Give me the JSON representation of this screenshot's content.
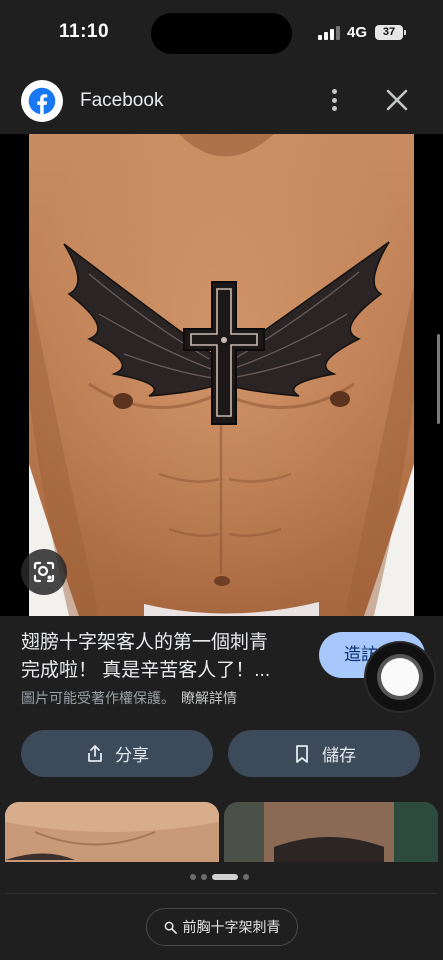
{
  "status_bar": {
    "time": "11:10",
    "network": "4G",
    "battery": "37"
  },
  "header": {
    "source_name": "Facebook",
    "icons": [
      "facebook-logo-icon",
      "more-vert-icon",
      "close-icon"
    ]
  },
  "image": {
    "lens_icon": "lens-search-icon"
  },
  "result": {
    "title": "翅膀十字架客人的第一個刺青完成啦！ 真是辛苦客人了！...",
    "title_line1": "翅膀十字架客人的第一個刺青",
    "title_line2": "完成啦！ 真是辛苦客人了！...",
    "copyright_notice": "圖片可能受著作權保護。",
    "learn_more": "瞭解詳情",
    "visit_label": "造訪"
  },
  "actions": {
    "share_label": "分享",
    "save_label": "儲存"
  },
  "pager": {
    "total": 4,
    "active_index": 2
  },
  "search_chip": {
    "label": "前胸十字架刺青"
  },
  "colors": {
    "background": "#1f1f1f",
    "visit_button": "#a8c7fa",
    "action_button": "#3c4a5a",
    "facebook_blue": "#1877f2"
  }
}
